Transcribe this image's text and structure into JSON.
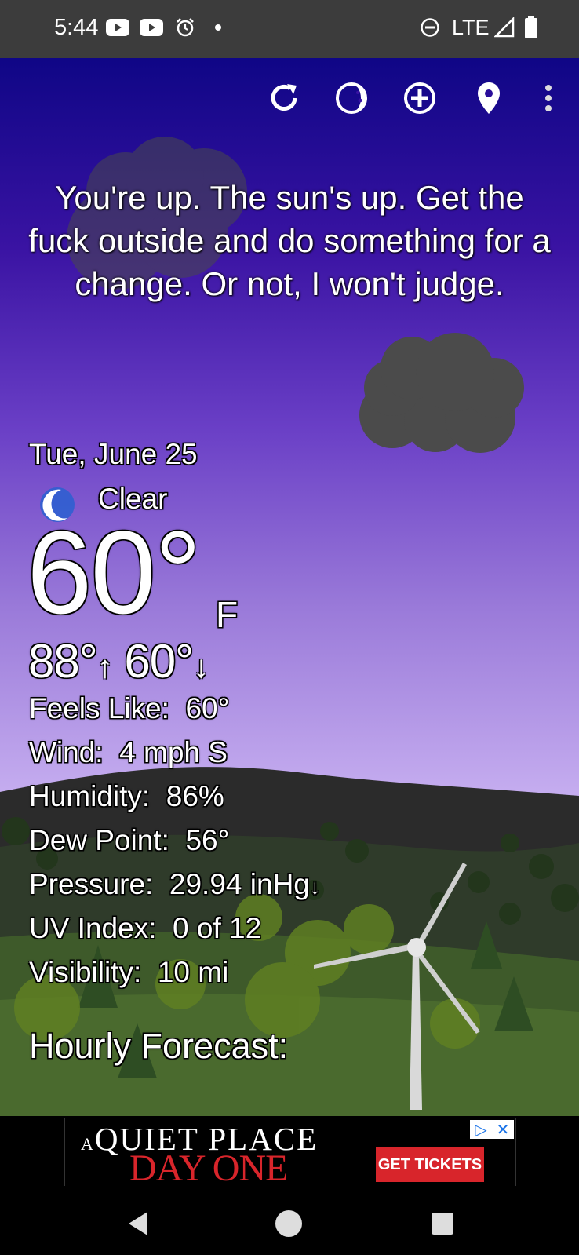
{
  "status_bar": {
    "time": "5:44",
    "network": "LTE",
    "icons": [
      "youtube-icon",
      "youtube-icon",
      "alarm-icon",
      "dot-icon",
      "do-not-disturb-icon",
      "signal-icon",
      "battery-icon"
    ]
  },
  "toolbar": {
    "icons": [
      "refresh-icon",
      "moon-phase-icon",
      "add-location-icon",
      "location-pin-icon",
      "more-vert-icon"
    ]
  },
  "quote": "You're up. The sun's up. Get the fuck outside and do something for a change. Or not, I won't judge.",
  "weather": {
    "date": "Tue, June 25",
    "condition": "Clear",
    "condition_icon": "moon-icon",
    "temp": "60°",
    "unit": "F",
    "high": "88°",
    "low": "60°",
    "details": [
      {
        "label": "Feels Like:",
        "value": "60°"
      },
      {
        "label": "Wind:",
        "value": "4 mph S"
      },
      {
        "label": "Humidity:",
        "value": "86%"
      },
      {
        "label": "Dew Point:",
        "value": "56°"
      },
      {
        "label": "Pressure:",
        "value": "29.94 inHg",
        "trend": "↓"
      },
      {
        "label": "UV Index:",
        "value": "0 of 12"
      },
      {
        "label": "Visibility:",
        "value": "10 mi"
      }
    ]
  },
  "hourly_heading": "Hourly Forecast:",
  "ad": {
    "line1_prefix": "A",
    "line1": "QUIET PLACE",
    "line2": "DAY ONE",
    "cta": "GET TICKETS",
    "accent": "#d8252b"
  },
  "nav_bar": {
    "icons": [
      "back-icon",
      "home-icon",
      "recents-icon"
    ]
  }
}
